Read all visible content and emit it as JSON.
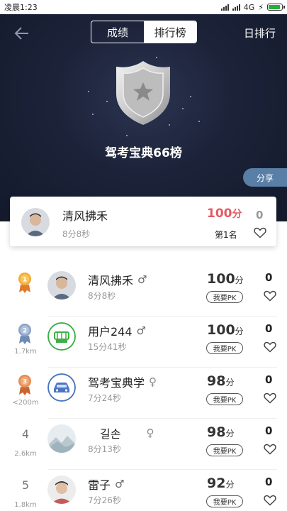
{
  "status_bar": {
    "time": "凌晨1:23",
    "network": "4G"
  },
  "header": {
    "tabs": [
      {
        "label": "成绩",
        "active": false
      },
      {
        "label": "排行榜",
        "active": true
      }
    ],
    "right_label": "日排行",
    "back_icon": "back-arrow-icon"
  },
  "hero": {
    "title": "驾考宝典66榜",
    "share_label": "分享",
    "badge_icon": "silver-shield-star-icon"
  },
  "my_card": {
    "name": "清风拂禾",
    "time": "8分8秒",
    "score": "100",
    "score_unit": "分",
    "rank": "第1名",
    "likes": "0"
  },
  "colors": {
    "hero_bg": "#1c2238",
    "my_score": "#e35b64",
    "share_bg": "#5a7fa6",
    "medal_gold": "#f2a93b",
    "medal_silver": "#8aa3c8",
    "medal_bronze": "#e58b54"
  },
  "rows": [
    {
      "rank": "",
      "medal": "gold",
      "distance": "",
      "name": "清风拂禾",
      "gender": "male",
      "time": "8分8秒",
      "score": "100",
      "unit": "分",
      "pk_label": "我要PK",
      "likes": "0"
    },
    {
      "rank": "",
      "medal": "silver",
      "distance": "1.7km",
      "name": "用户244",
      "gender": "male",
      "time": "15分41秒",
      "score": "100",
      "unit": "分",
      "pk_label": "我要PK",
      "likes": "0"
    },
    {
      "rank": "",
      "medal": "bronze",
      "distance": "<200m",
      "name": "驾考宝典学",
      "gender": "female",
      "time": "7分24秒",
      "score": "98",
      "unit": "分",
      "pk_label": "我要PK",
      "likes": "0"
    },
    {
      "rank": "4",
      "medal": "",
      "distance": "2.6km",
      "name": "길손",
      "gender": "female",
      "time": "8分13秒",
      "score": "98",
      "unit": "分",
      "pk_label": "我要PK",
      "likes": "0"
    },
    {
      "rank": "5",
      "medal": "",
      "distance": "1.8km",
      "name": "雷子",
      "gender": "male",
      "time": "7分26秒",
      "score": "92",
      "unit": "分",
      "pk_label": "我要PK",
      "likes": "0"
    }
  ]
}
